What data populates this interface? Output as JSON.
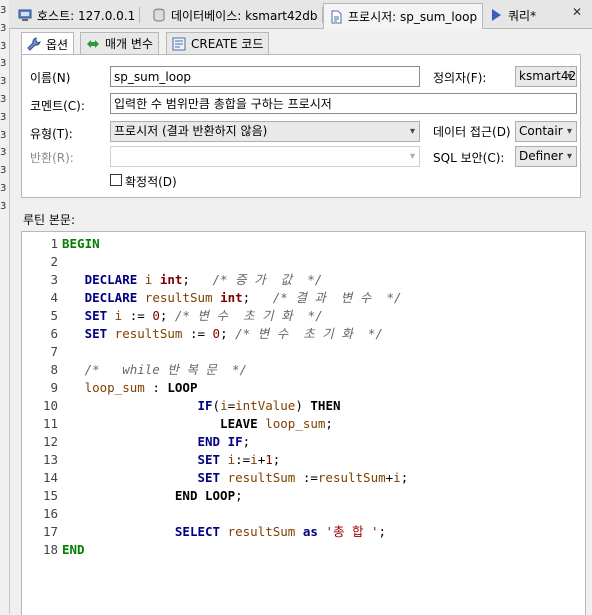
{
  "gutter": {
    "digits": [
      "3",
      "3",
      "3",
      "3",
      "3",
      "3",
      "3",
      "3",
      "3",
      "3",
      "3",
      "3"
    ]
  },
  "tabs": [
    {
      "label": "호스트: 127.0.0.1",
      "icon": "host-icon"
    },
    {
      "label": "데이터베이스: ksmart42db",
      "icon": "database-icon"
    },
    {
      "label": "프로시저: sp_sum_loop",
      "icon": "procedure-icon",
      "active": true
    },
    {
      "label": "쿼리*",
      "icon": "run-query-icon"
    }
  ],
  "close_label": "✕",
  "inner_tabs": [
    {
      "label": "옵션",
      "icon": "wrench-icon",
      "active": true
    },
    {
      "label": "매개 변수",
      "icon": "arrows-icon"
    },
    {
      "label": "CREATE 코드",
      "icon": "code-icon"
    }
  ],
  "form": {
    "name_label": "이름(N)",
    "name_value": "sp_sum_loop",
    "definer_label": "정의자(F):",
    "definer_value": "ksmart42",
    "comment_label": "코멘트(C):",
    "comment_value": "입력한 수 범위만큼 총합을 구하는 프로시저",
    "type_label": "유형(T):",
    "type_value": "프로시저 (결과 반환하지 않음)",
    "data_access_label": "데이터 접근(D)",
    "data_access_value": "Contair",
    "returns_label": "반환(R):",
    "returns_value": "",
    "sql_security_label": "SQL 보안(C):",
    "sql_security_value": "Definer",
    "deterministic_label": "확정적(D)",
    "deterministic_checked": false
  },
  "routine_label": "루틴 본문:",
  "code_lines": [
    {
      "n": "1",
      "segs": [
        {
          "t": "BEGIN",
          "c": "kwg"
        }
      ]
    },
    {
      "n": "2",
      "segs": []
    },
    {
      "n": "3",
      "segs": [
        {
          "t": "   ",
          "c": "op"
        },
        {
          "t": "DECLARE",
          "c": "kw"
        },
        {
          "t": " i ",
          "c": "id"
        },
        {
          "t": "int",
          "c": "ty"
        },
        {
          "t": ";   ",
          "c": "op"
        },
        {
          "t": "/* 증 가  값  */",
          "c": "cm"
        }
      ]
    },
    {
      "n": "4",
      "segs": [
        {
          "t": "   ",
          "c": "op"
        },
        {
          "t": "DECLARE",
          "c": "kw"
        },
        {
          "t": " resultSum ",
          "c": "id"
        },
        {
          "t": "int",
          "c": "ty"
        },
        {
          "t": ";   ",
          "c": "op"
        },
        {
          "t": "/* 결 과  변 수  */",
          "c": "cm"
        }
      ]
    },
    {
      "n": "5",
      "segs": [
        {
          "t": "   ",
          "c": "op"
        },
        {
          "t": "SET",
          "c": "kw"
        },
        {
          "t": " i ",
          "c": "id"
        },
        {
          "t": ":= ",
          "c": "op"
        },
        {
          "t": "0",
          "c": "num"
        },
        {
          "t": "; ",
          "c": "op"
        },
        {
          "t": "/* 변 수  초 기 화  */",
          "c": "cm"
        }
      ]
    },
    {
      "n": "6",
      "segs": [
        {
          "t": "   ",
          "c": "op"
        },
        {
          "t": "SET",
          "c": "kw"
        },
        {
          "t": " resultSum ",
          "c": "id"
        },
        {
          "t": ":= ",
          "c": "op"
        },
        {
          "t": "0",
          "c": "num"
        },
        {
          "t": "; ",
          "c": "op"
        },
        {
          "t": "/* 변 수  초 기 화  */",
          "c": "cm"
        }
      ]
    },
    {
      "n": "7",
      "segs": []
    },
    {
      "n": "8",
      "segs": [
        {
          "t": "   ",
          "c": "op"
        },
        {
          "t": "/*   while 반 복 문  */",
          "c": "cm"
        }
      ]
    },
    {
      "n": "9",
      "segs": [
        {
          "t": "   ",
          "c": "op"
        },
        {
          "t": "loop_sum",
          "c": "id"
        },
        {
          "t": " : ",
          "c": "op"
        },
        {
          "t": "LOOP",
          "c": "kwb"
        }
      ]
    },
    {
      "n": "10",
      "segs": [
        {
          "t": "                  ",
          "c": "op"
        },
        {
          "t": "IF",
          "c": "kw"
        },
        {
          "t": "(",
          "c": "op"
        },
        {
          "t": "i",
          "c": "id"
        },
        {
          "t": "=",
          "c": "op"
        },
        {
          "t": "intValue",
          "c": "id"
        },
        {
          "t": ") ",
          "c": "op"
        },
        {
          "t": "THEN",
          "c": "kwb"
        }
      ]
    },
    {
      "n": "11",
      "segs": [
        {
          "t": "                     ",
          "c": "op"
        },
        {
          "t": "LEAVE",
          "c": "kwb"
        },
        {
          "t": " loop_sum",
          "c": "id"
        },
        {
          "t": ";",
          "c": "op"
        }
      ]
    },
    {
      "n": "12",
      "segs": [
        {
          "t": "                  ",
          "c": "op"
        },
        {
          "t": "END IF",
          "c": "kw"
        },
        {
          "t": ";",
          "c": "op"
        }
      ]
    },
    {
      "n": "13",
      "segs": [
        {
          "t": "                  ",
          "c": "op"
        },
        {
          "t": "SET",
          "c": "kw"
        },
        {
          "t": " i",
          "c": "id"
        },
        {
          "t": ":=",
          "c": "op"
        },
        {
          "t": "i",
          "c": "id"
        },
        {
          "t": "+",
          "c": "op"
        },
        {
          "t": "1",
          "c": "num"
        },
        {
          "t": ";",
          "c": "op"
        }
      ]
    },
    {
      "n": "14",
      "segs": [
        {
          "t": "                  ",
          "c": "op"
        },
        {
          "t": "SET",
          "c": "kw"
        },
        {
          "t": " resultSum ",
          "c": "id"
        },
        {
          "t": ":=",
          "c": "op"
        },
        {
          "t": "resultSum",
          "c": "id"
        },
        {
          "t": "+",
          "c": "op"
        },
        {
          "t": "i",
          "c": "id"
        },
        {
          "t": ";",
          "c": "op"
        }
      ]
    },
    {
      "n": "15",
      "segs": [
        {
          "t": "               ",
          "c": "op"
        },
        {
          "t": "END LOOP",
          "c": "kwb"
        },
        {
          "t": ";",
          "c": "op"
        }
      ]
    },
    {
      "n": "16",
      "segs": []
    },
    {
      "n": "17",
      "segs": [
        {
          "t": "               ",
          "c": "op"
        },
        {
          "t": "SELECT",
          "c": "kw"
        },
        {
          "t": " resultSum ",
          "c": "id"
        },
        {
          "t": "as",
          "c": "kw"
        },
        {
          "t": " ",
          "c": "op"
        },
        {
          "t": "'총 합 '",
          "c": "str"
        },
        {
          "t": ";",
          "c": "op"
        }
      ]
    },
    {
      "n": "18",
      "segs": [
        {
          "t": "END",
          "c": "kwg"
        }
      ]
    }
  ]
}
